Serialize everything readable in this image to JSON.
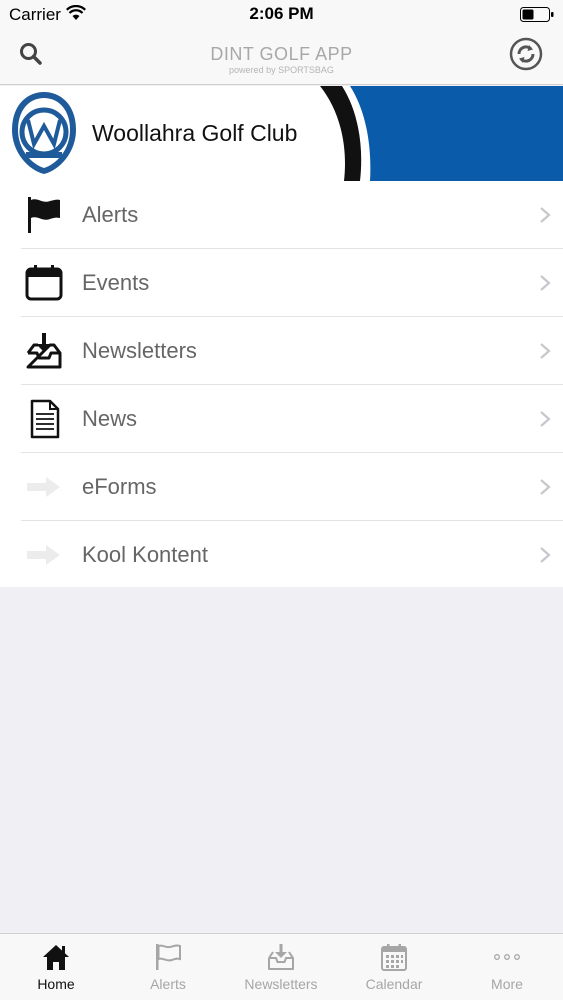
{
  "status_bar": {
    "carrier": "Carrier",
    "time": "2:06 PM"
  },
  "nav_bar": {
    "title": "DINT GOLF APP",
    "subtitle": "powered by SPORTSBAG",
    "search_icon": "search-icon",
    "refresh_icon": "refresh-icon"
  },
  "banner": {
    "club_name": "Woollahra Golf Club",
    "accent_color": "#0a5cab"
  },
  "menu": {
    "items": [
      {
        "label": "Alerts",
        "icon": "flag-icon"
      },
      {
        "label": "Events",
        "icon": "calendar-icon"
      },
      {
        "label": "Newsletters",
        "icon": "inbox-download-icon"
      },
      {
        "label": "News",
        "icon": "document-icon"
      },
      {
        "label": "eForms",
        "icon": "arrow-right-icon"
      },
      {
        "label": "Kool Kontent",
        "icon": "arrow-right-icon"
      }
    ]
  },
  "tab_bar": {
    "tabs": [
      {
        "label": "Home",
        "icon": "home-icon",
        "active": true
      },
      {
        "label": "Alerts",
        "icon": "flag-icon",
        "active": false
      },
      {
        "label": "Newsletters",
        "icon": "inbox-download-icon",
        "active": false
      },
      {
        "label": "Calendar",
        "icon": "calendar-icon",
        "active": false
      },
      {
        "label": "More",
        "icon": "more-dots-icon",
        "active": false
      }
    ]
  }
}
